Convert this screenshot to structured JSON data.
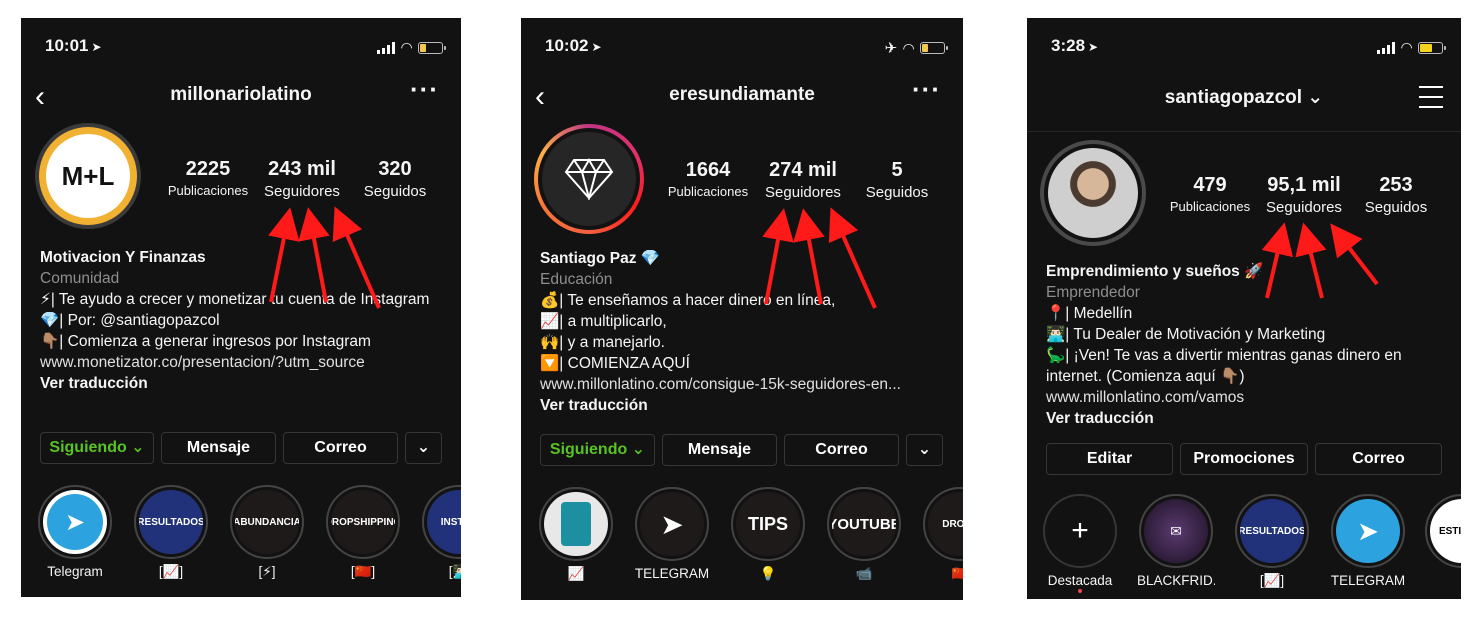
{
  "accent": {
    "arrow": "#ff1a1a",
    "following_green": "#58c322",
    "story_navy": "#21327a",
    "telegram_blue": "#2ca3df"
  },
  "phones": [
    {
      "time": "10:01",
      "username": "millonariolatino",
      "avatar_text": "M+L",
      "stats": [
        {
          "num": "2225",
          "label": "Publicaciones"
        },
        {
          "num": "243 mil",
          "label": "Seguidores"
        },
        {
          "num": "320",
          "label": "Seguidos"
        }
      ],
      "bio": {
        "name": "Motivacion Y Finanzas",
        "category": "Comunidad",
        "lines": [
          "⚡| Te ayudo a crecer y monetizar tu cuenta de Instagram",
          "💎| Por: @santiagopazcol",
          "👇🏽| Comienza a generar ingresos por Instagram"
        ],
        "link": "www.monetizator.co/presentacion/?utm_source",
        "translate": "Ver traducción"
      },
      "buttons": [
        "Siguiendo ⌄",
        "Mensaje",
        "Correo",
        "⌄"
      ],
      "stories": [
        {
          "text": "",
          "label": "Telegram"
        },
        {
          "text": "RESULTADOS",
          "label": "[📈]"
        },
        {
          "text": "ABUNDANCIA",
          "label": "[⚡]"
        },
        {
          "text": "DROPSHIPPING",
          "label": "[🇨🇳]"
        },
        {
          "text": "INSTAR",
          "label": "[👨🏻‍💻"
        }
      ]
    },
    {
      "time": "10:02",
      "username": "eresundiamante",
      "stats": [
        {
          "num": "1664",
          "label": "Publicaciones"
        },
        {
          "num": "274 mil",
          "label": "Seguidores"
        },
        {
          "num": "5",
          "label": "Seguidos"
        }
      ],
      "bio": {
        "name": "Santiago Paz 💎",
        "category": "Educación",
        "lines": [
          "💰| Te enseñamos a hacer dinero en línea,",
          "📈| a multiplicarlo,",
          "🙌| y a manejarlo.",
          "🔽| COMIENZA AQUÍ"
        ],
        "link": "www.millonlatino.com/consigue-15k-seguidores-en...",
        "translate": "Ver traducción"
      },
      "buttons": [
        "Siguiendo ⌄",
        "Mensaje",
        "Correo",
        "⌄"
      ],
      "stories": [
        {
          "text": "",
          "label": "📈"
        },
        {
          "text": "",
          "label": "TELEGRAM"
        },
        {
          "text": "TIPS",
          "label": "💡"
        },
        {
          "text": "YOUTUBE",
          "label": "📹"
        },
        {
          "text": "DROPS",
          "label": "🇨🇳"
        }
      ]
    },
    {
      "time": "3:28",
      "username": "santiagopazcol ⌄",
      "stats": [
        {
          "num": "479",
          "label": "Publicaciones"
        },
        {
          "num": "95,1 mil",
          "label": "Seguidores"
        },
        {
          "num": "253",
          "label": "Seguidos"
        }
      ],
      "bio": {
        "name": "Emprendimiento y sueños 🚀",
        "category": "Emprendedor",
        "lines": [
          "📍| Medellín",
          "👨🏻‍💻| Tu Dealer de Motivación y Marketing",
          "🦕| ¡Ven! Te vas a divertir mientras ganas dinero en internet. (Comienza aquí 👇🏽)"
        ],
        "link": "www.millonlatino.com/vamos",
        "translate": "Ver traducción"
      },
      "buttons": [
        "Editar",
        "Promociones",
        "Correo"
      ],
      "stories": [
        {
          "text": "+",
          "label": "Destacada"
        },
        {
          "text": "",
          "label": "BLACKFRID..."
        },
        {
          "text": "RESULTADOS",
          "label": "[📈]"
        },
        {
          "text": "",
          "label": "TELEGRAM"
        },
        {
          "text": "ESTILO D",
          "label": "["
        }
      ]
    }
  ]
}
